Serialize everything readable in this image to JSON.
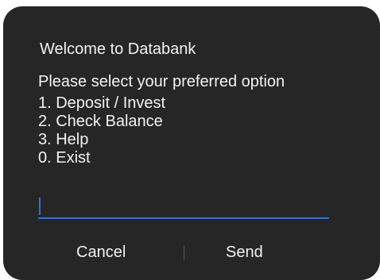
{
  "dialog": {
    "title": "Welcome to Databank",
    "prompt": "Please select your preferred option",
    "options": [
      "1. Deposit / Invest",
      "2. Check Balance",
      "3. Help",
      "0. Exist"
    ],
    "input": {
      "value": "",
      "placeholder": ""
    },
    "buttons": {
      "cancel": "Cancel",
      "send": "Send"
    }
  },
  "colors": {
    "background": "#262626",
    "text": "#f2f2f2",
    "accent": "#2f6fe0"
  }
}
